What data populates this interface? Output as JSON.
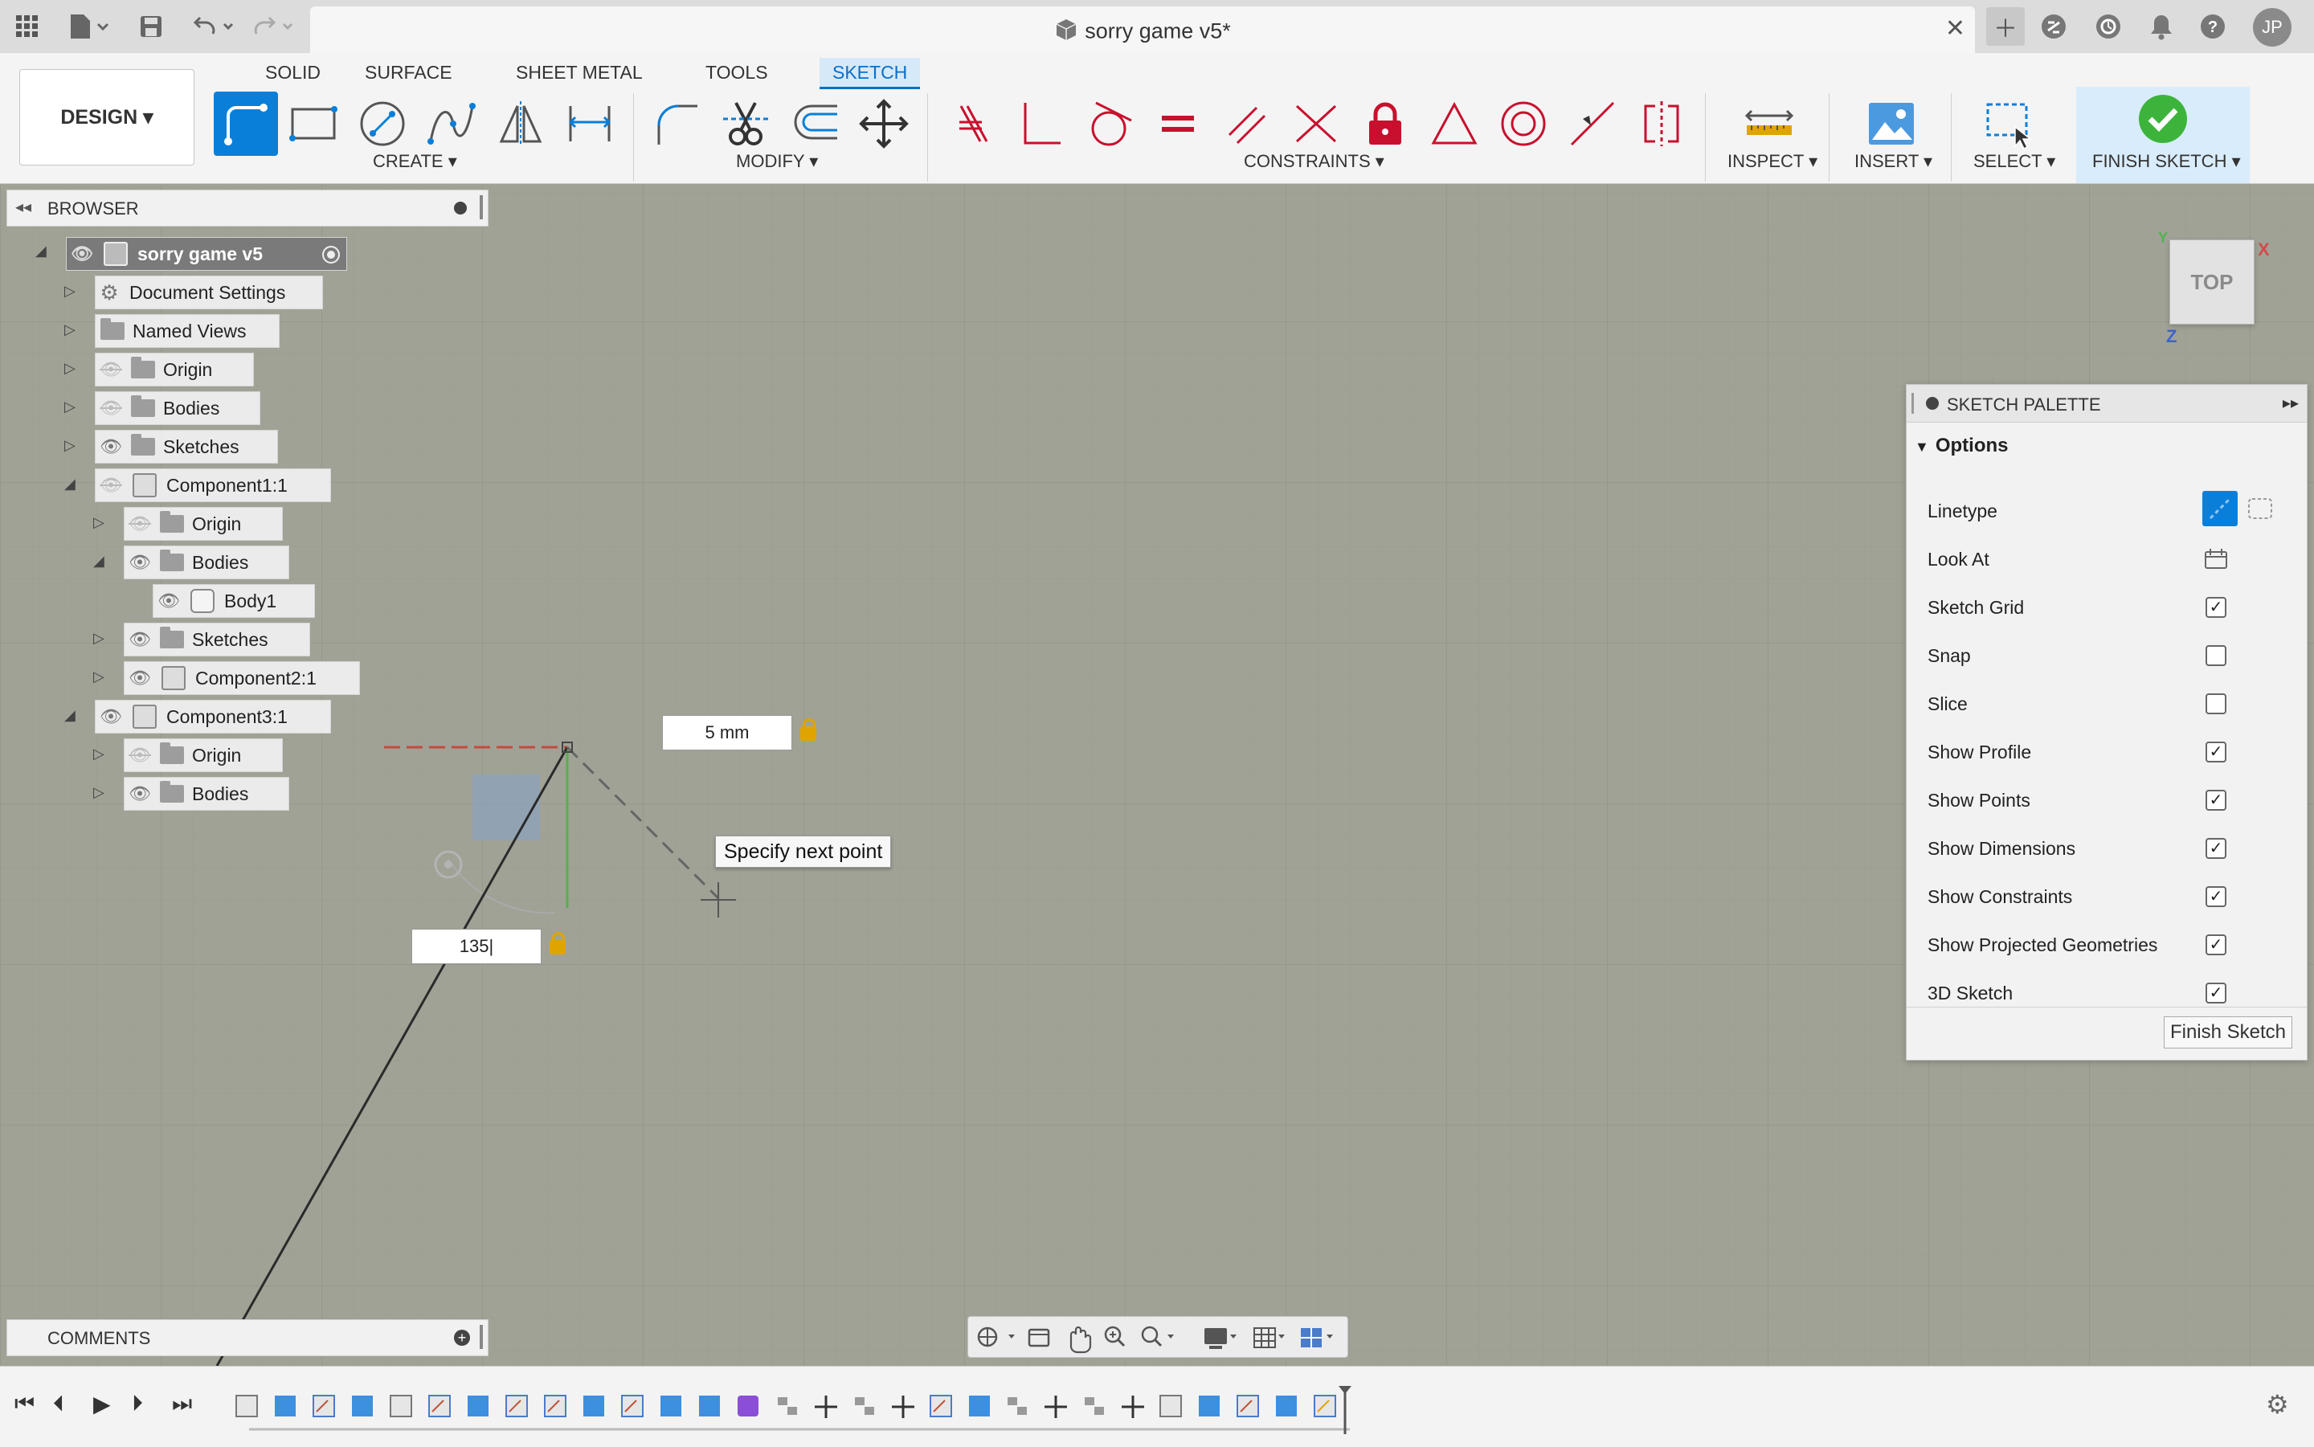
{
  "app": {
    "document_title": "sorry game v5*",
    "user_initials": "JP"
  },
  "toolbar": {
    "workspace": "DESIGN ▾",
    "tabs": [
      {
        "label": "SOLID",
        "active": false
      },
      {
        "label": "SURFACE",
        "active": false
      },
      {
        "label": "SHEET METAL",
        "active": false
      },
      {
        "label": "TOOLS",
        "active": false
      },
      {
        "label": "SKETCH",
        "active": true
      }
    ],
    "groups": {
      "create": "CREATE ▾",
      "modify": "MODIFY ▾",
      "constraints": "CONSTRAINTS ▾",
      "inspect": "INSPECT ▾",
      "insert": "INSERT ▾",
      "select": "SELECT ▾",
      "finish": "FINISH SKETCH ▾"
    },
    "accent_color": "#0a7fd9"
  },
  "browser": {
    "title": "BROWSER",
    "nodes": [
      {
        "label": "sorry game v5"
      },
      {
        "label": "Document Settings"
      },
      {
        "label": "Named Views"
      },
      {
        "label": "Origin"
      },
      {
        "label": "Bodies"
      },
      {
        "label": "Sketches"
      },
      {
        "label": "Component1:1"
      },
      {
        "label": "Origin"
      },
      {
        "label": "Bodies"
      },
      {
        "label": "Body1"
      },
      {
        "label": "Sketches"
      },
      {
        "label": "Component2:1"
      },
      {
        "label": "Component3:1"
      },
      {
        "label": "Origin"
      },
      {
        "label": "Bodies"
      }
    ]
  },
  "comments": {
    "title": "COMMENTS"
  },
  "canvas": {
    "viewcube_label": "TOP",
    "axis_x": "X",
    "axis_y": "Y",
    "axis_z": "Z",
    "length_input": "5 mm",
    "angle_input": "135|",
    "tooltip": "Specify next point"
  },
  "palette": {
    "title": "SKETCH PALETTE",
    "section": "Options",
    "rows": [
      {
        "label": "Linetype"
      },
      {
        "label": "Look At"
      },
      {
        "label": "Sketch Grid",
        "checked": true
      },
      {
        "label": "Snap",
        "checked": false
      },
      {
        "label": "Slice",
        "checked": false
      },
      {
        "label": "Show Profile",
        "checked": true
      },
      {
        "label": "Show Points",
        "checked": true
      },
      {
        "label": "Show Dimensions",
        "checked": true
      },
      {
        "label": "Show Constraints",
        "checked": true
      },
      {
        "label": "Show Projected Geometries",
        "checked": true
      },
      {
        "label": "3D Sketch",
        "checked": true
      }
    ],
    "finish_button": "Finish Sketch"
  }
}
